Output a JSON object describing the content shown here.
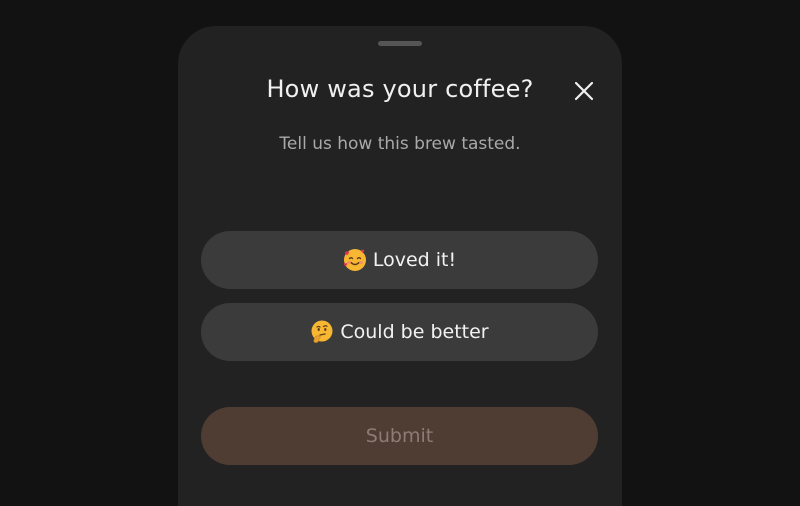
{
  "modal": {
    "title": "How was your coffee?",
    "subtitle": "Tell us how this brew tasted.",
    "options": [
      {
        "label": "Loved it!",
        "icon": "smiling-face-with-hearts-icon"
      },
      {
        "label": "Could be better",
        "icon": "thinking-face-icon"
      }
    ],
    "submit_label": "Submit"
  },
  "colors": {
    "page_background": "#121212",
    "sheet_background": "#222222",
    "option_background": "#3b3b3b",
    "submit_background": "#4f3d33",
    "submit_text": "#8c7c73"
  }
}
